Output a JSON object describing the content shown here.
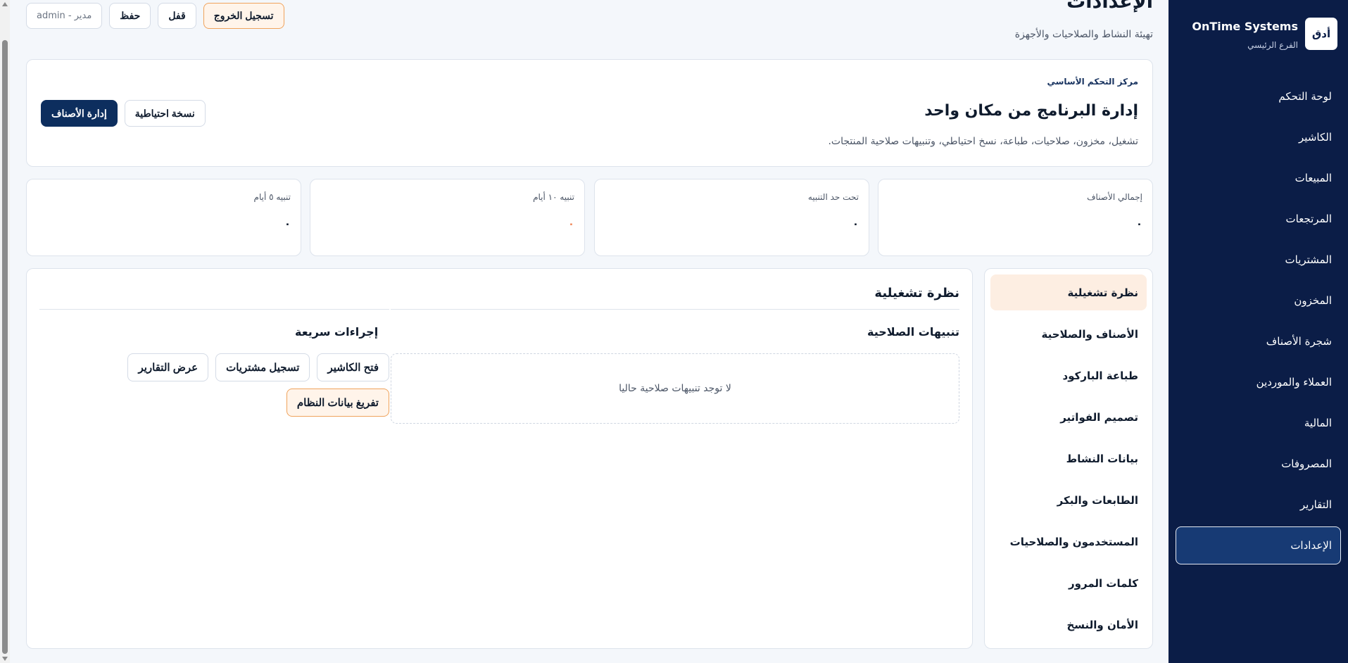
{
  "brand": {
    "title": "OnTime Systems",
    "subtitle": "الفرع الرئيسي",
    "logo_text": "أدق"
  },
  "sidebar": {
    "items": [
      {
        "label": "لوحة التحكم"
      },
      {
        "label": "الكاشير"
      },
      {
        "label": "المبيعات"
      },
      {
        "label": "المرتجعات"
      },
      {
        "label": "المشتريات"
      },
      {
        "label": "المخزون"
      },
      {
        "label": "شجرة الأصناف"
      },
      {
        "label": "العملاء والموردين"
      },
      {
        "label": "المالية"
      },
      {
        "label": "المصروفات"
      },
      {
        "label": "التقارير"
      },
      {
        "label": "الإعدادات",
        "active": true
      }
    ]
  },
  "header": {
    "title": "الإعدادات",
    "subtitle": "تهيئة النشاط والصلاحيات والأجهزة",
    "user": "admin - مدير",
    "save_label": "حفظ",
    "lock_label": "قفل",
    "logout_label": "تسجيل الخروج"
  },
  "hero": {
    "eyebrow": "مركز التحكم الأساسي",
    "title": "إدارة البرنامج من مكان واحد",
    "description": "تشغيل، مخزون، صلاحيات، طباعة، نسخ احتياطي، وتنبيهات صلاحية المنتجات.",
    "primary_label": "إدارة الأصناف",
    "backup_label": "نسخة احتياطية"
  },
  "stats": [
    {
      "label": "إجمالي الأصناف",
      "value": "٠"
    },
    {
      "label": "تحت حد التنبيه",
      "value": "٠"
    },
    {
      "label": "تنبيه ١٠ أيام",
      "value": "٠"
    },
    {
      "label": "تنبيه ٥ أيام",
      "value": "٠"
    }
  ],
  "subnav": {
    "items": [
      {
        "label": "نظرة تشغيلية",
        "active": true
      },
      {
        "label": "الأصناف والصلاحية"
      },
      {
        "label": "طباعة الباركود"
      },
      {
        "label": "تصميم الفواتير"
      },
      {
        "label": "بيانات النشاط"
      },
      {
        "label": "الطابعات والبكر"
      },
      {
        "label": "المستخدمون والصلاحيات"
      },
      {
        "label": "كلمات المرور"
      },
      {
        "label": "الأمان والنسخ"
      }
    ]
  },
  "main": {
    "title": "نظرة تشغيلية",
    "expiry_title": "تنبيهات الصلاحية",
    "expiry_empty": "لا توجد تنبيهات صلاحية حاليا",
    "quick_title": "إجراءات سريعة",
    "quick_actions": [
      {
        "label": "فتح الكاشير"
      },
      {
        "label": "تسجيل مشتريات"
      },
      {
        "label": "عرض التقارير"
      },
      {
        "label": "تفريغ بيانات النظام"
      }
    ]
  },
  "colors": {
    "sidebar_bg": "#0b1d47",
    "primary": "#0d2e5e",
    "accent": "#f0a35c",
    "warning_value": "#f08a5d"
  }
}
